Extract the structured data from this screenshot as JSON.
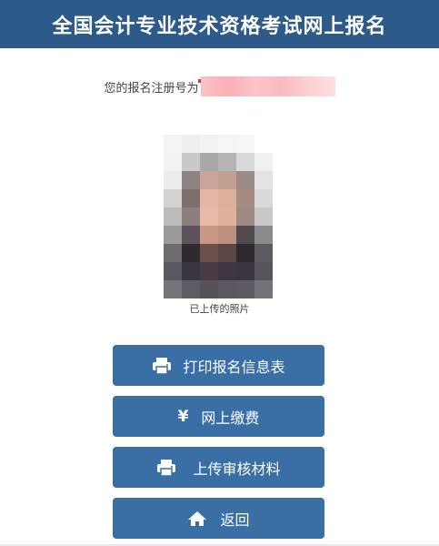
{
  "header": {
    "title": "全国会计专业技术资格考试网上报名"
  },
  "registration": {
    "label": "您的报名注册号为"
  },
  "photo": {
    "caption": "已上传的照片"
  },
  "buttons": {
    "print_info": "打印报名信息表",
    "pay_online": "网上缴费",
    "upload_materials": "上传审核材料",
    "back": "返回"
  },
  "icons": {
    "print": "printer-icon",
    "pay": "yen-icon",
    "upload": "printer-icon",
    "back": "home-icon"
  },
  "colors": {
    "header_bg": "#2d5a88",
    "button_bg": "#3a6fa5"
  }
}
